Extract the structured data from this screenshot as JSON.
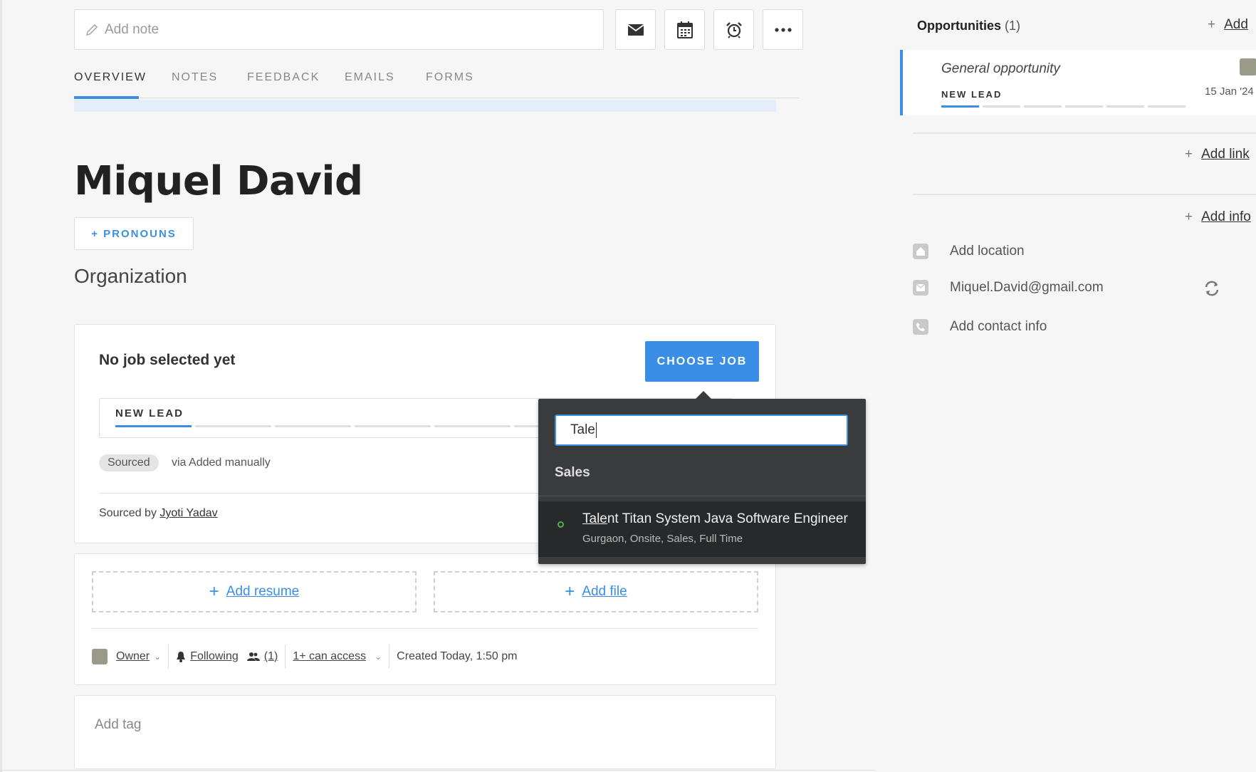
{
  "toolbar": {
    "note_placeholder": "Add note",
    "actions": [
      "email-icon",
      "calendar-icon",
      "alarm-icon",
      "more-icon"
    ]
  },
  "tabs": [
    {
      "label": "OVERVIEW",
      "active": true
    },
    {
      "label": "NOTES",
      "active": false
    },
    {
      "label": "FEEDBACK",
      "active": false
    },
    {
      "label": "EMAILS",
      "active": false
    },
    {
      "label": "FORMS",
      "active": false
    }
  ],
  "profile": {
    "name": "Miquel David",
    "pronouns_button": "+ PRONOUNS",
    "organization": "Organization"
  },
  "job_card": {
    "title": "No job selected yet",
    "choose_button": "CHOOSE JOB",
    "stage": "NEW LEAD",
    "source_pill": "Sourced",
    "source_via": "via Added manually",
    "sourced_by_label": "Sourced by",
    "sourced_by_name": "Jyoti Yadav"
  },
  "files_card": {
    "add_resume": "Add resume",
    "add_file": "Add file",
    "owner": "Owner",
    "following": "Following",
    "followers": "(1)",
    "access": "1+ can access",
    "created": "Created Today, 1:50 pm"
  },
  "tags": {
    "placeholder": "Add tag"
  },
  "job_dropdown": {
    "search_value": "Tale",
    "group": "Sales",
    "item_match": "Tale",
    "item_rest": "nt Titan System Java Software Engineer",
    "item_subtitle": "Gurgaon, Onsite, Sales, Full Time"
  },
  "sidebar": {
    "opportunities_label": "Opportunities",
    "opportunities_count": "(1)",
    "add_label": "Add",
    "opportunity": {
      "title": "General opportunity",
      "stage": "NEW LEAD",
      "date": "15 Jan '24"
    },
    "add_link": "Add link",
    "add_info": "Add info",
    "contacts": [
      {
        "icon": "home-icon",
        "text": "Add location"
      },
      {
        "icon": "mail-icon",
        "text": "Miquel.David@gmail.com"
      },
      {
        "icon": "phone-icon",
        "text": "Add contact info"
      }
    ]
  },
  "colors": {
    "accent": "#3a8ee6",
    "popup_bg": "#3a3b3d"
  }
}
